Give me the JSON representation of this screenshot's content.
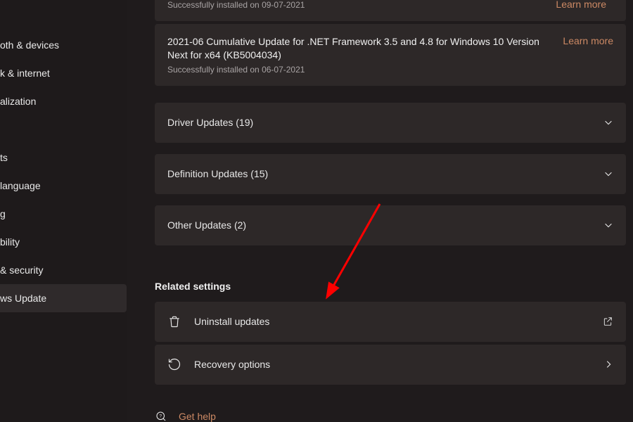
{
  "sidebar": {
    "items": [
      {
        "label": "oth & devices"
      },
      {
        "label": "k & internet"
      },
      {
        "label": "alization"
      },
      {
        "label": ""
      },
      {
        "label": "ts"
      },
      {
        "label": " language"
      },
      {
        "label": "g"
      },
      {
        "label": "bility"
      },
      {
        "label": " & security"
      },
      {
        "label": "ws Update"
      }
    ]
  },
  "updates": {
    "u0": {
      "sub": "Successfully installed on 09-07-2021",
      "learn": "Learn more"
    },
    "u1": {
      "title": "2021-06 Cumulative Update for .NET Framework 3.5 and 4.8 for Windows 10 Version Next for x64 (KB5004034)",
      "sub": "Successfully installed on 06-07-2021",
      "learn": "Learn more"
    }
  },
  "expanders": {
    "driver": "Driver Updates (19)",
    "definition": "Definition Updates (15)",
    "other": "Other Updates (2)"
  },
  "related": {
    "heading": "Related settings",
    "uninstall": "Uninstall updates",
    "recovery": "Recovery options"
  },
  "help": {
    "label": "Get help"
  },
  "colors": {
    "accent": "#cc8964",
    "card": "#2d2828",
    "bg": "#1f1b1c"
  }
}
